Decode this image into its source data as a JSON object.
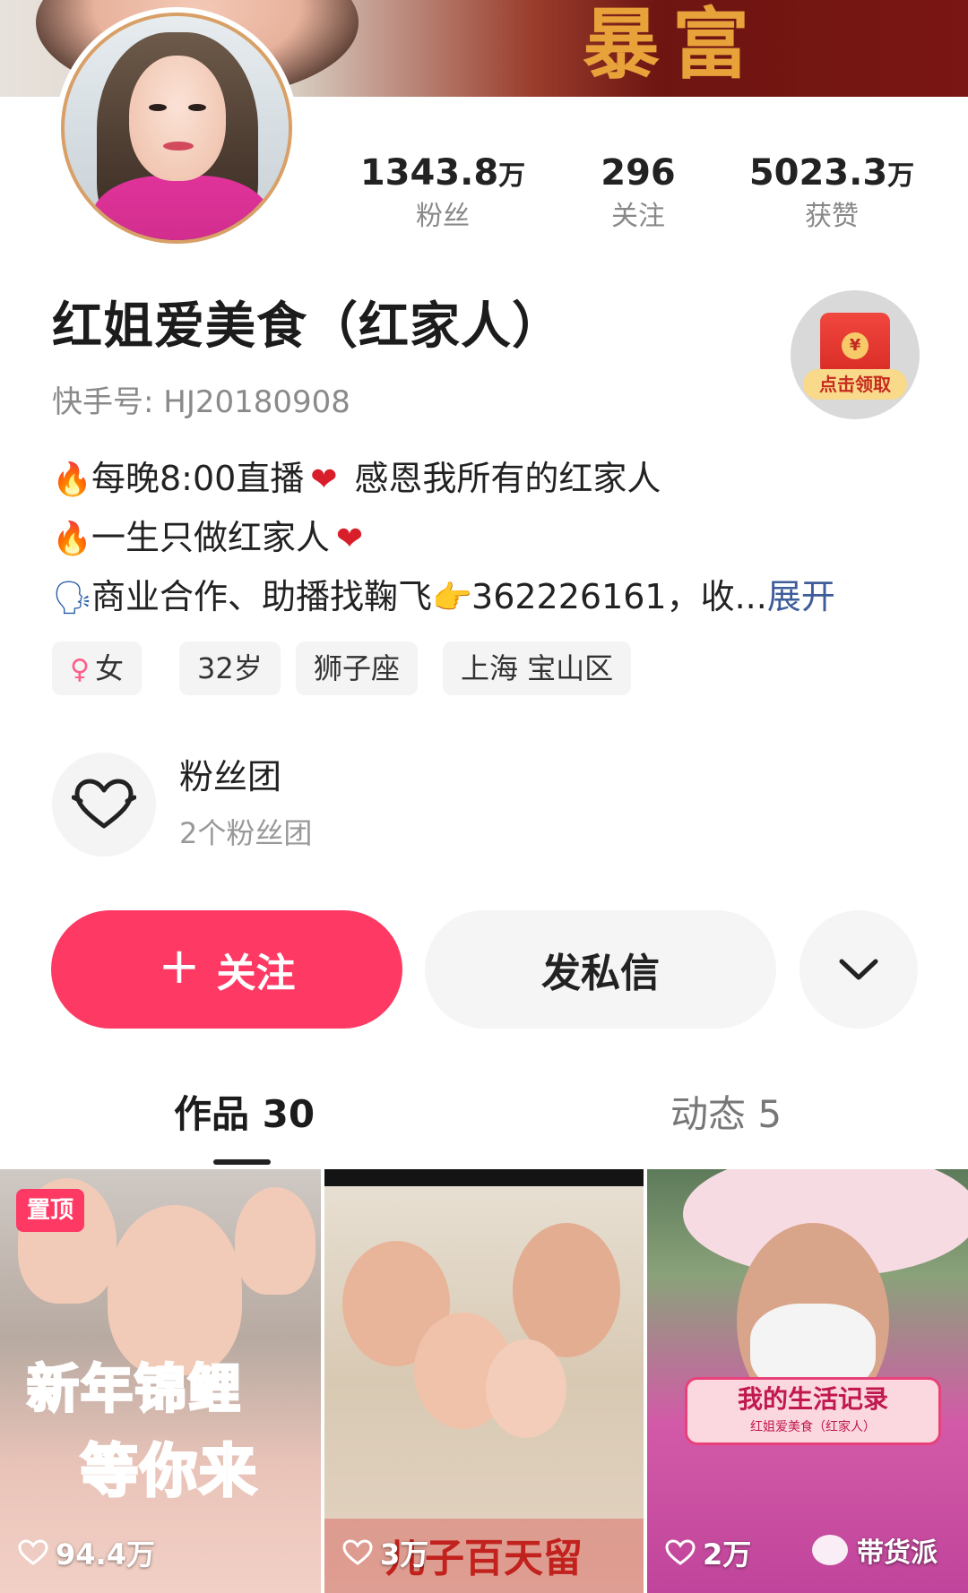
{
  "banner": {
    "text": "暴富"
  },
  "stats": [
    {
      "number": "1343.8",
      "unit": "万",
      "label": "粉丝"
    },
    {
      "number": "296",
      "unit": "",
      "label": "关注"
    },
    {
      "number": "5023.3",
      "unit": "万",
      "label": "获赞"
    }
  ],
  "profile": {
    "name": "红姐爱美食（红家人）",
    "user_id": "快手号: HJ20180908",
    "red_packet_label": "点击领取",
    "red_packet_coin": "¥"
  },
  "bio": {
    "line1": "每晚8:00直播",
    "line1_rest": " 感恩我所有的红家人",
    "line2": "一生只做红家人",
    "line3": "商业合作、助播找鞠飞",
    "line3_rest": "362226161，收...",
    "expand": "展开"
  },
  "tags": [
    "女",
    "32岁",
    "狮子座",
    "上海 宝山区"
  ],
  "fan_club": {
    "title": "粉丝团",
    "subtitle": "2个粉丝团"
  },
  "actions": {
    "follow": "关注",
    "message": "发私信"
  },
  "tabs": {
    "works": "作品 30",
    "moments": "动态 5"
  },
  "videos": [
    {
      "pinned": "置顶",
      "headline1": "新年锦鲤",
      "headline2": "等你来",
      "likes": "94.4万"
    },
    {
      "caption": "儿子百天留",
      "likes": "3万"
    },
    {
      "label": "我的生活记录",
      "label_sub": "红姐爱美食（红家人）",
      "likes": "2万"
    }
  ],
  "watermark": "带货派",
  "colors": {
    "accent": "#fe3a64",
    "expand_link": "#3d5c9a"
  }
}
